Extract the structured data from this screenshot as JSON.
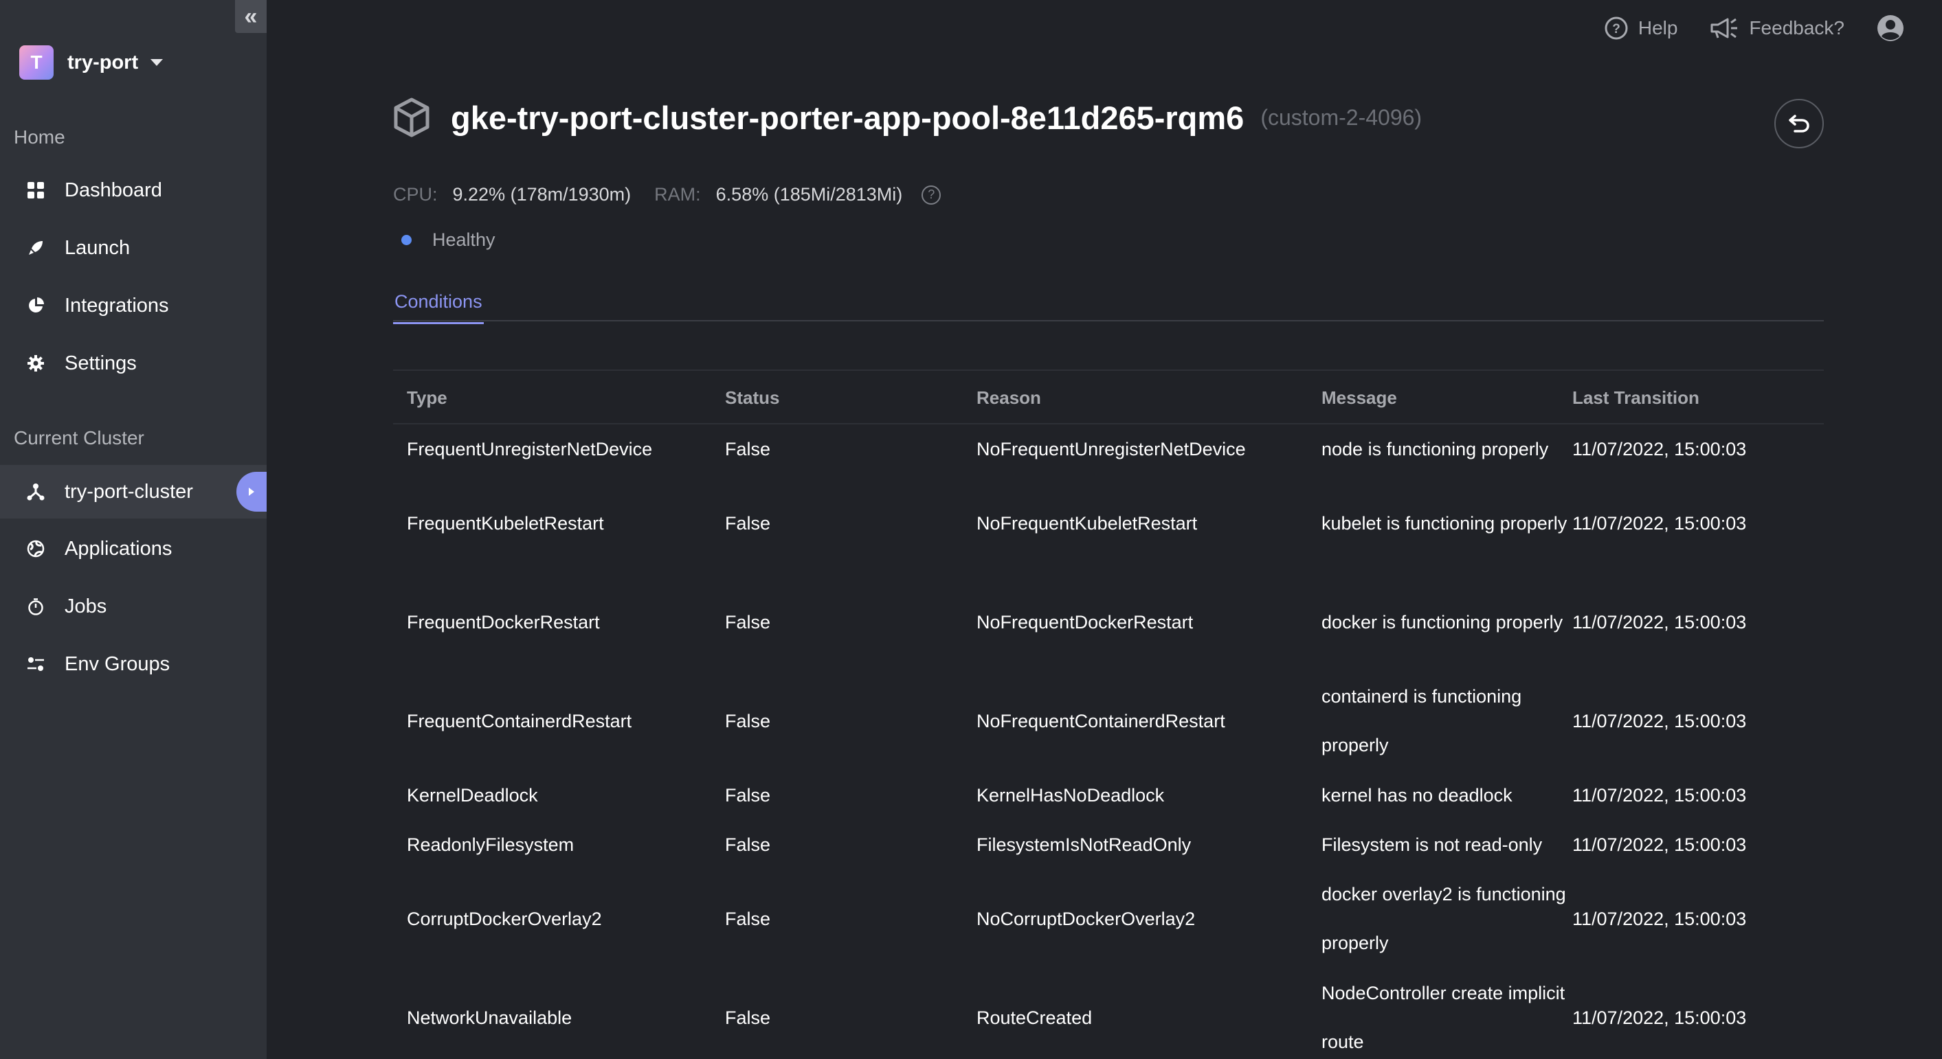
{
  "sidebar": {
    "collapse_label": "«",
    "project": {
      "initial": "T",
      "name": "try-port"
    },
    "home_label": "Home",
    "home_items": [
      {
        "label": "Dashboard",
        "icon": "dashboard-icon"
      },
      {
        "label": "Launch",
        "icon": "rocket-icon"
      },
      {
        "label": "Integrations",
        "icon": "pie-chart-icon"
      },
      {
        "label": "Settings",
        "icon": "gear-icon"
      }
    ],
    "cluster_label": "Current Cluster",
    "cluster_items": [
      {
        "label": "try-port-cluster",
        "icon": "cluster-icon",
        "active": true
      },
      {
        "label": "Applications",
        "icon": "globe-icon"
      },
      {
        "label": "Jobs",
        "icon": "stopwatch-icon"
      },
      {
        "label": "Env Groups",
        "icon": "sliders-icon"
      }
    ]
  },
  "topbar": {
    "help_label": "Help",
    "feedback_label": "Feedback?"
  },
  "node": {
    "name": "gke-try-port-cluster-porter-app-pool-8e11d265-rqm6",
    "machine_type": "(custom-2-4096)",
    "cpu_label": "CPU:",
    "cpu_value": "9.22% (178m/1930m)",
    "ram_label": "RAM:",
    "ram_value": "6.58% (185Mi/2813Mi)",
    "help_glyph": "?",
    "status": "Healthy",
    "status_color": "#5c8cf2"
  },
  "tabs": [
    {
      "label": "Conditions",
      "active": true
    }
  ],
  "table": {
    "headers": [
      "Type",
      "Status",
      "Reason",
      "Message",
      "Last Transition"
    ],
    "rows": [
      {
        "type": "FrequentUnregisterNetDevice",
        "status": "False",
        "reason": "NoFrequentUnregisterNetDevice",
        "message": "node is functioning properly",
        "last": "11/07/2022, 15:00:03"
      },
      {
        "type": "FrequentKubeletRestart",
        "status": "False",
        "reason": "NoFrequentKubeletRestart",
        "message": "kubelet is functioning properly",
        "last": "11/07/2022, 15:00:03"
      },
      {
        "type": "FrequentDockerRestart",
        "status": "False",
        "reason": "NoFrequentDockerRestart",
        "message": "docker is functioning properly",
        "last": "11/07/2022, 15:00:03"
      },
      {
        "type": "FrequentContainerdRestart",
        "status": "False",
        "reason": "NoFrequentContainerdRestart",
        "message": "containerd is functioning properly",
        "last": "11/07/2022, 15:00:03"
      },
      {
        "type": "KernelDeadlock",
        "status": "False",
        "reason": "KernelHasNoDeadlock",
        "message": "kernel has no deadlock",
        "last": "11/07/2022, 15:00:03"
      },
      {
        "type": "ReadonlyFilesystem",
        "status": "False",
        "reason": "FilesystemIsNotReadOnly",
        "message": "Filesystem is not read-only",
        "last": "11/07/2022, 15:00:03"
      },
      {
        "type": "CorruptDockerOverlay2",
        "status": "False",
        "reason": "NoCorruptDockerOverlay2",
        "message": "docker overlay2 is functioning properly",
        "last": "11/07/2022, 15:00:03"
      },
      {
        "type": "NetworkUnavailable",
        "status": "False",
        "reason": "RouteCreated",
        "message": "NodeController create implicit route",
        "last": "11/07/2022, 15:00:03"
      }
    ]
  },
  "colors": {
    "background": "#202227",
    "sidebar": "#2f3238",
    "accent": "#8c95f2"
  }
}
